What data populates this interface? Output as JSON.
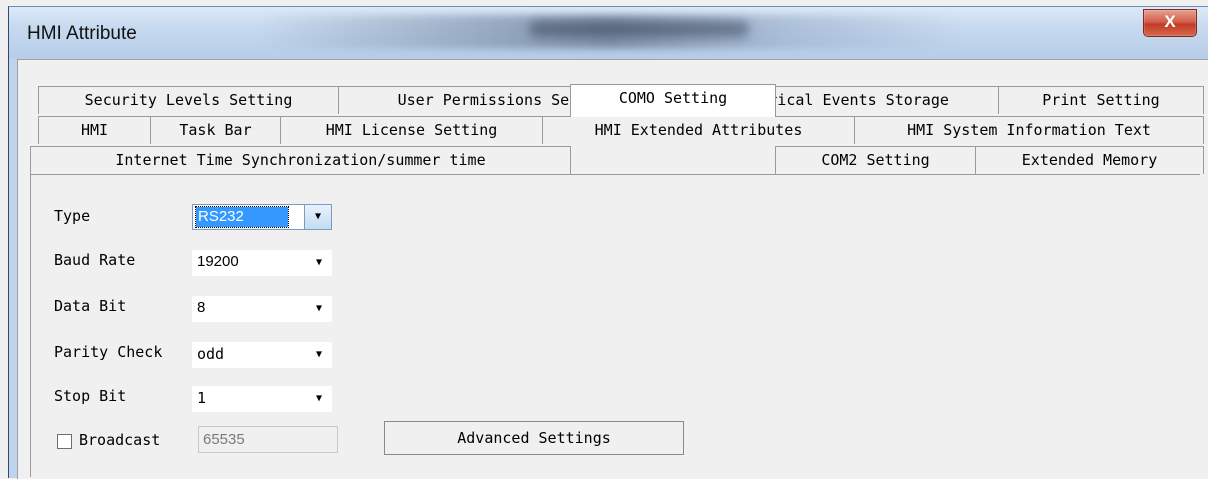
{
  "window": {
    "title": "HMI Attribute",
    "close_label": "X"
  },
  "tabs_row1": [
    "Security Levels Setting",
    "User Permissions Setting",
    "Historical Events Storage",
    "Print Setting"
  ],
  "tabs_row2": [
    "HMI",
    "Task Bar",
    "HMI License Setting",
    "HMI Extended Attributes",
    "HMI System Information Text"
  ],
  "tabs_row3": [
    "Internet Time Synchronization/summer time",
    "COMO Setting",
    "COM2 Setting",
    "Extended Memory"
  ],
  "active_tab": "COMO Setting",
  "form": {
    "type": {
      "label": "Type",
      "value": "RS232"
    },
    "baud": {
      "label": "Baud Rate",
      "value": "19200"
    },
    "data_bit": {
      "label": "Data Bit",
      "value": "8"
    },
    "parity": {
      "label": "Parity Check",
      "value": "odd"
    },
    "stop_bit": {
      "label": "Stop Bit",
      "value": "1"
    },
    "broadcast": {
      "label": "Broadcast",
      "value": "65535",
      "checked": false
    },
    "advanced_label": "Advanced Settings"
  },
  "colors": {
    "selection": "#3399ff",
    "close_red": "#c23a23",
    "titlebar": "#c6d9ef"
  }
}
